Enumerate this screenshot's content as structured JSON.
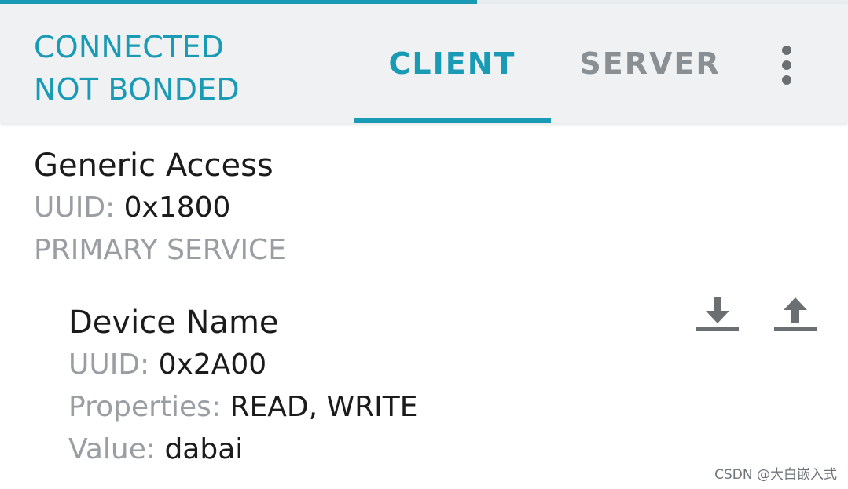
{
  "progress": {
    "fraction": 0.563,
    "color": "#1a9bb5"
  },
  "header": {
    "status_connection": "CONNECTED",
    "status_bond": "NOT BONDED",
    "tabs": [
      {
        "label": "CLIENT",
        "selected": true
      },
      {
        "label": "SERVER",
        "selected": false
      }
    ],
    "overflow_icon": "more-vert-icon"
  },
  "service": {
    "name": "Generic Access",
    "uuid_label": "UUID:",
    "uuid": "0x1800",
    "type": "PRIMARY SERVICE"
  },
  "characteristic": {
    "name": "Device Name",
    "uuid_label": "UUID:",
    "uuid": "0x2A00",
    "properties_label": "Properties:",
    "properties": "READ, WRITE",
    "value_label": "Value:",
    "value": "dabai",
    "read_icon": "download-icon",
    "write_icon": "upload-icon"
  },
  "watermark": "CSDN @大白嵌入式",
  "colors": {
    "accent": "#1a9bb5",
    "inactive_tab": "#8a8f93",
    "header_bg": "#f0f1f2",
    "label_gray": "#9a9ea2",
    "icon_gray": "#6b6f72"
  }
}
